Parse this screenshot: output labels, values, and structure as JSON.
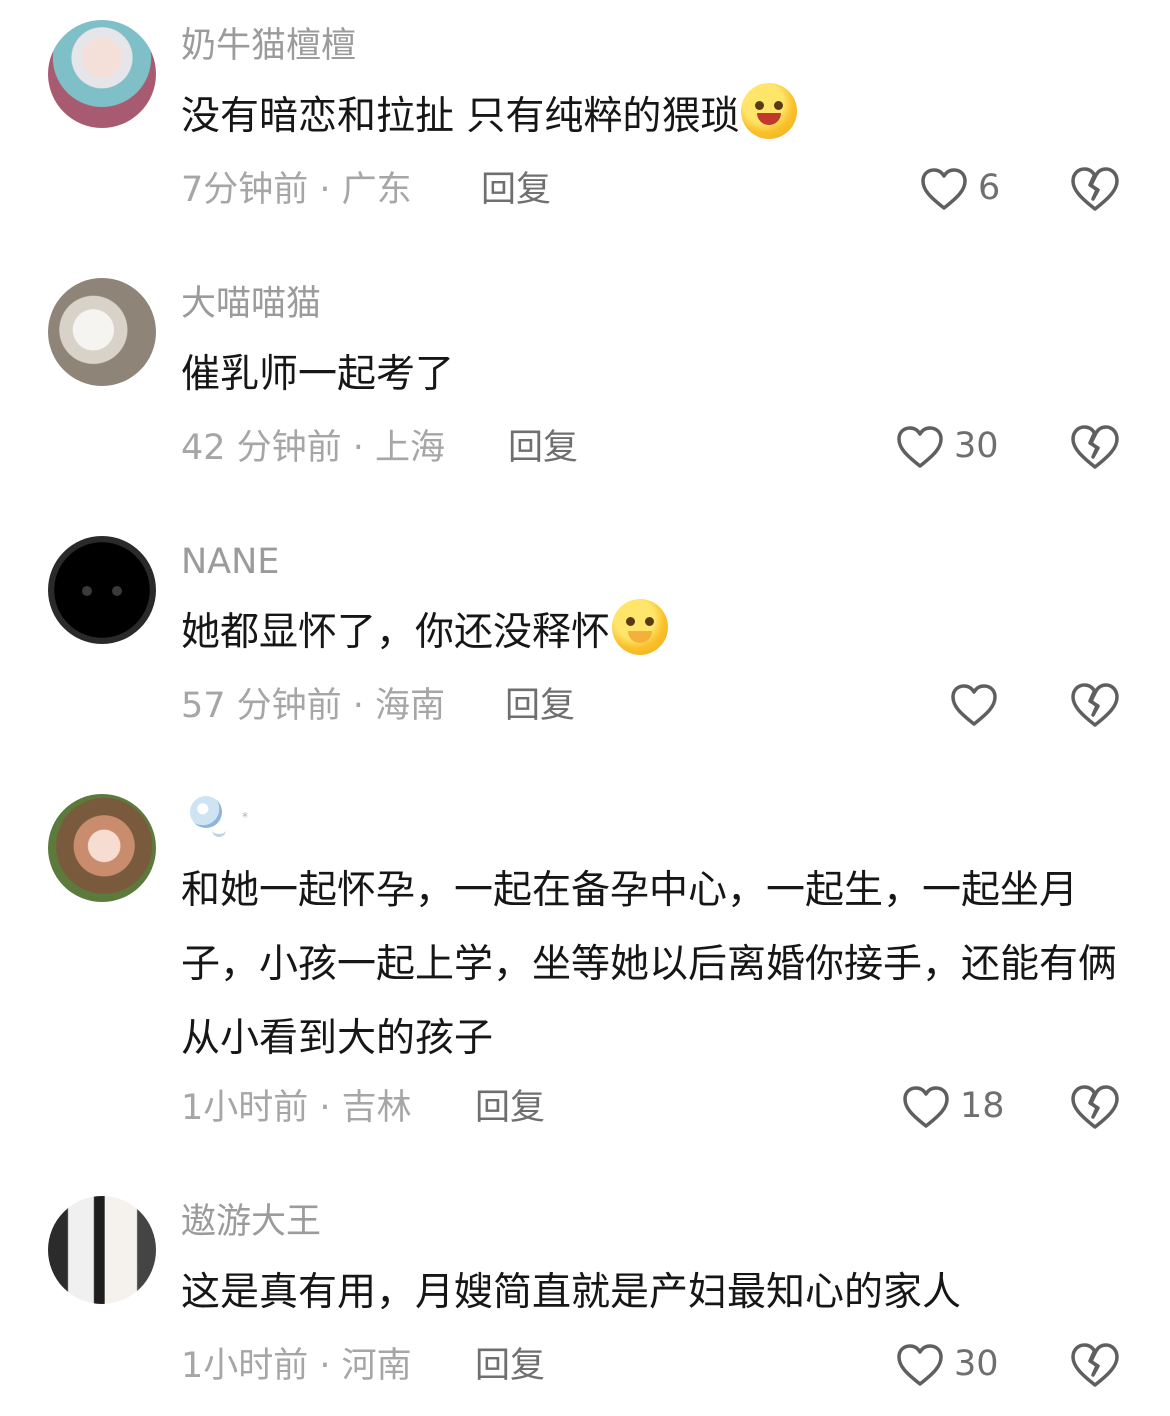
{
  "comments": [
    {
      "username": "奶牛猫檀檀",
      "text": "没有暗恋和拉扯 只有纯粹的猥琐",
      "emoji": "rolling-laughing-emoji",
      "time_location": "7分钟前 · 广东",
      "reply_label": "回复",
      "like_count": "6"
    },
    {
      "username": "大喵喵猫",
      "text": "催乳师一起考了",
      "emoji": "",
      "time_location": "42 分钟前 · 上海",
      "reply_label": "回复",
      "like_count": "30"
    },
    {
      "username": "NANE",
      "text": "她都显怀了，你还没释怀",
      "emoji": "teary-covering-mouth-emoji",
      "time_location": "57 分钟前 · 海南",
      "reply_label": "回复",
      "like_count": ""
    },
    {
      "username": "*",
      "text": "和她一起怀孕，一起在备孕中心，一起生，一起坐月子，小孩一起上学，坐等她以后离婚你接手，还能有俩从小看到大的孩子",
      "emoji": "",
      "time_location": "1小时前 · 吉林",
      "reply_label": "回复",
      "like_count": "18"
    },
    {
      "username": "遨游大王",
      "text": "这是真有用，月嫂简直就是产妇最知心的家人",
      "emoji": "",
      "time_location": "1小时前 · 河南",
      "reply_label": "回复",
      "like_count": "30"
    }
  ],
  "icons": {
    "like": "heart-outline-icon",
    "dislike": "broken-heart-icon"
  },
  "colors": {
    "username": "#9b9b9b",
    "text": "#161616",
    "meta": "#a6a6a6",
    "action": "#6f6f6f"
  }
}
